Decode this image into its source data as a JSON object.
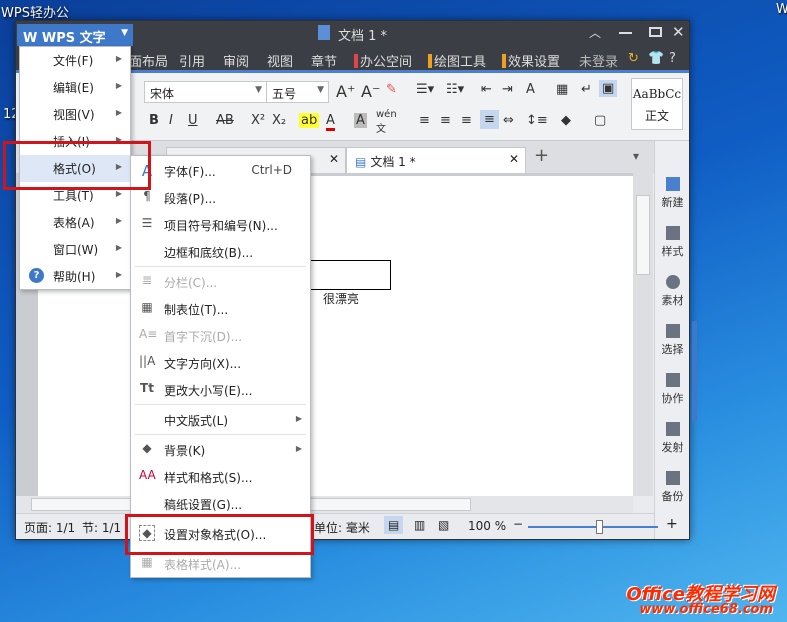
{
  "desktop": {
    "top_left_label": "WPS轻办公",
    "top_right_label": "W",
    "side_label": "12"
  },
  "window": {
    "app_button": "WPS 文字",
    "title": "文档 1 *",
    "menu_tabs": [
      {
        "label": "页面布局"
      },
      {
        "label": "引用"
      },
      {
        "label": "审阅"
      },
      {
        "label": "视图"
      },
      {
        "label": "章节"
      },
      {
        "label": "办公空间",
        "bar": "#e0454b"
      },
      {
        "label": "绘图工具",
        "bar": "#f0a020"
      },
      {
        "label": "效果设置",
        "bar": "#f0a020"
      }
    ],
    "login": "未登录",
    "help": "?",
    "font_name": "宋体",
    "font_size": "五号",
    "style_preview": "AaBbCc",
    "style_name": "正文",
    "doc_tabs": [
      {
        "label": "..."
      },
      {
        "label": "文档 1 *"
      }
    ],
    "doc_text": "很漂亮"
  },
  "sidebar": {
    "items": [
      {
        "label": "新建"
      },
      {
        "label": "样式"
      },
      {
        "label": "素材"
      },
      {
        "label": "选择"
      },
      {
        "label": "协作"
      },
      {
        "label": "发射"
      },
      {
        "label": "备份"
      }
    ]
  },
  "status": {
    "page": "页面: 1/1",
    "section": "节: 1/1",
    "unit": "单位: 毫米",
    "zoom": "100 %",
    "zoom_value": 100
  },
  "main_menu": {
    "items": [
      {
        "label": "文件(F)"
      },
      {
        "label": "编辑(E)"
      },
      {
        "label": "视图(V)"
      },
      {
        "label": "插入(I)"
      },
      {
        "label": "格式(O)"
      },
      {
        "label": "工具(T)"
      },
      {
        "label": "表格(A)"
      },
      {
        "label": "窗口(W)"
      },
      {
        "label": "帮助(H)"
      }
    ]
  },
  "format_menu": {
    "items": [
      {
        "label": "字体(F)...",
        "shortcut": "Ctrl+D"
      },
      {
        "label": "段落(P)..."
      },
      {
        "label": "项目符号和编号(N)..."
      },
      {
        "label": "边框和底纹(B)..."
      },
      {
        "label": "分栏(C)..."
      },
      {
        "label": "制表位(T)..."
      },
      {
        "label": "首字下沉(D)..."
      },
      {
        "label": "文字方向(X)..."
      },
      {
        "label": "更改大小写(E)..."
      },
      {
        "label": "中文版式(L)"
      },
      {
        "label": "背景(K)"
      },
      {
        "label": "样式和格式(S)..."
      },
      {
        "label": "稿纸设置(G)..."
      },
      {
        "label": "设置对象格式(O)..."
      },
      {
        "label": "表格样式(A)..."
      }
    ]
  },
  "watermark": {
    "line1": "Office教程学习网",
    "line2": "www.office68.com"
  },
  "colors": {
    "accent": "#3d78c9",
    "highlight": "#d0141a",
    "titlebar": "#3b3e44"
  }
}
